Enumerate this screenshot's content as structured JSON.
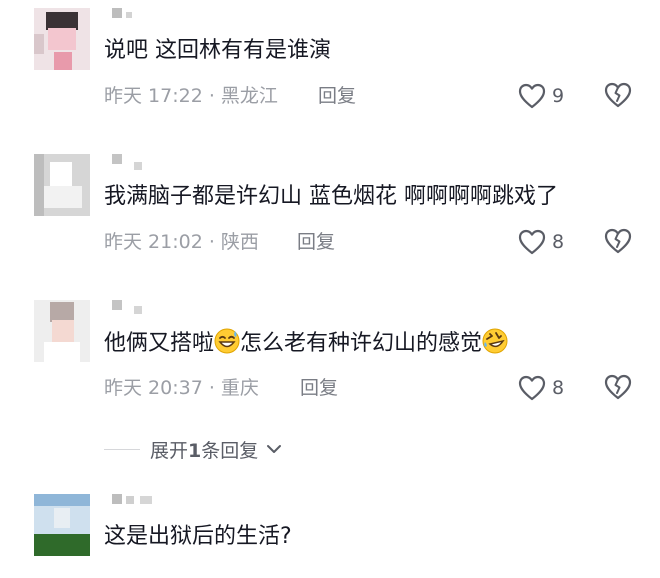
{
  "comments": [
    {
      "text": "说吧 这回林有有是谁演",
      "meta": "昨天 17:22 · 黑龙江",
      "reply_label": "回复",
      "likes": "9"
    },
    {
      "text": "我满脑子都是许幻山 蓝色烟花 啊啊啊啊跳戏了",
      "meta": "昨天 21:02 · 陕西",
      "reply_label": "回复",
      "likes": "8"
    },
    {
      "text_part1": "他俩又搭啦",
      "text_part2": "怎么老有种许幻山的感觉",
      "meta": "昨天 20:37 · 重庆",
      "reply_label": "回复",
      "likes": "8"
    },
    {
      "text": "这是出狱后的生活?"
    }
  ],
  "expand_replies": {
    "prefix": "展开",
    "count": "1",
    "suffix": "条回复"
  },
  "icons": {
    "like": "heart-outline-icon",
    "dislike": "broken-heart-icon",
    "emoji_1": "sweat-smile-emoji",
    "emoji_2": "rolling-laugh-emoji",
    "expand": "chevron-down-icon"
  }
}
